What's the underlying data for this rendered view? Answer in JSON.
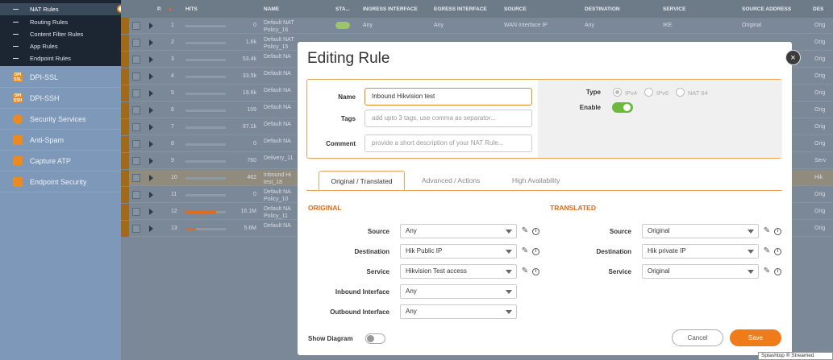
{
  "sidebar": {
    "sub_items": [
      {
        "label": "NAT Rules",
        "active": true
      },
      {
        "label": "Routing Rules"
      },
      {
        "label": "Content Filter Rules"
      },
      {
        "label": "App Rules"
      },
      {
        "label": "Endpoint Rules"
      }
    ],
    "items": [
      {
        "label": "DPI-SSL",
        "icon": "DPI SSL"
      },
      {
        "label": "DPI-SSH",
        "icon": "DPI SSH"
      },
      {
        "label": "Security Services",
        "icon": "shield"
      },
      {
        "label": "Anti-Spam",
        "icon": "mail"
      },
      {
        "label": "Capture ATP",
        "icon": "atp"
      },
      {
        "label": "Endpoint Security",
        "icon": "endpoint"
      }
    ]
  },
  "table": {
    "columns": [
      "P.",
      "HITS",
      "NAME",
      "STA...",
      "INGRESS INTERFACE",
      "EGRESS INTERFACE",
      "SOURCE",
      "DESTINATION",
      "SERVICE",
      "SOURCE ADDRESS",
      "DES"
    ],
    "rows": [
      {
        "priority": "1",
        "hits": "0",
        "name": "Default NAT Policy_16",
        "usage": 0,
        "ingress": "Any",
        "egress": "Any",
        "source": "WAN Interface IP",
        "destination": "Any",
        "service": "IKE",
        "source_address": "Original",
        "tail": "Orig"
      },
      {
        "priority": "2",
        "hits": "1.6k",
        "name": "Default NAT Policy_15",
        "usage": 0,
        "tail": "Orig"
      },
      {
        "priority": "3",
        "hits": "53.4k",
        "name": "Default NA",
        "usage": 0,
        "tail": "Orig"
      },
      {
        "priority": "4",
        "hits": "33.5k",
        "name": "Default NA",
        "usage": 0,
        "tail": "Orig"
      },
      {
        "priority": "5",
        "hits": "19.6k",
        "name": "Default NA",
        "usage": 0,
        "tail": "Orig"
      },
      {
        "priority": "6",
        "hits": "109",
        "name": "Default NA",
        "usage": 0,
        "tail": "Orig"
      },
      {
        "priority": "7",
        "hits": "97.1k",
        "name": "Default NA",
        "usage": 0,
        "tail": "Orig"
      },
      {
        "priority": "8",
        "hits": "0",
        "name": "Default NA",
        "usage": 0,
        "tail": "Orig"
      },
      {
        "priority": "9",
        "hits": "760",
        "name": "Delivery_11",
        "usage": 0,
        "tail": "Serv"
      },
      {
        "priority": "10",
        "hits": "462",
        "name": "Inbound Hi test_18",
        "usage": 0,
        "tail": "Hik",
        "highlight": true
      },
      {
        "priority": "11",
        "hits": "0",
        "name": "Default NA Policy_10",
        "usage": 0,
        "tail": "Orig"
      },
      {
        "priority": "12",
        "hits": "16.1M",
        "name": "Default NA Policy_11",
        "usage": 0.75,
        "tail": "Orig"
      },
      {
        "priority": "13",
        "hits": "5.6M",
        "name": "Default NA",
        "usage": 0.26,
        "tail": "Orig"
      }
    ]
  },
  "modal": {
    "title": "Editing Rule",
    "close": "×",
    "name_label": "Name",
    "name_value": "Inbound Hikvision test",
    "tags_label": "Tags",
    "tags_placeholder": "add upto 3 tags, use comma as separator...",
    "comment_label": "Comment",
    "comment_placeholder": "provide a short description of your NAT Rule...",
    "type_label": "Type",
    "type_options": [
      "IPv4",
      "IPv6",
      "NAT 64"
    ],
    "type_selected": "IPv4",
    "enable_label": "Enable",
    "enable_on": true,
    "tabs": [
      "Original / Translated",
      "Advanced / Actions",
      "High Availability"
    ],
    "active_tab": "Original / Translated",
    "original": {
      "title": "ORIGINAL",
      "source_label": "Source",
      "source": "Any",
      "destination_label": "Destination",
      "destination": "Hik Public IP",
      "service_label": "Service",
      "service": "Hikvision Test access",
      "inbound_label": "Inbound Interface",
      "inbound": "Any",
      "outbound_label": "Outbound Interface",
      "outbound": "Any"
    },
    "translated": {
      "title": "TRANSLATED",
      "source_label": "Source",
      "source": "Original",
      "destination_label": "Destination",
      "destination": "Hik private IP",
      "service_label": "Service",
      "service": "Original"
    },
    "show_diagram_label": "Show Diagram",
    "show_diagram_on": false,
    "cancel_label": "Cancel",
    "save_label": "Save"
  },
  "watermark": "Splashtop ® Streamed",
  "colors": {
    "accent": "#f07b1b",
    "enable": "#6cb93c",
    "sidebar_dark": "#1c2632"
  }
}
